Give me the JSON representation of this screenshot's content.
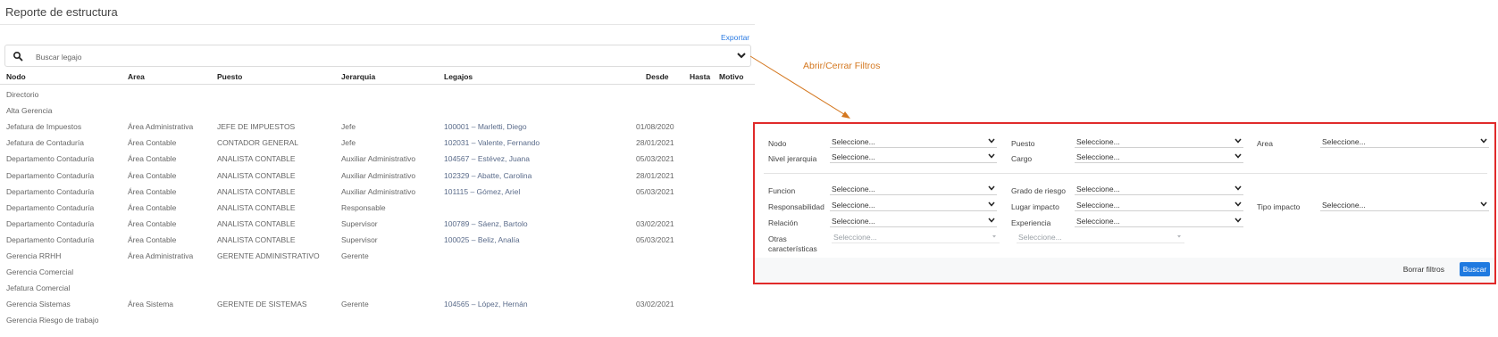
{
  "header": {
    "title": "Reporte de estructura",
    "export_label": "Exportar"
  },
  "search": {
    "placeholder": "Buscar legajo",
    "icon": "search-icon",
    "toggle_icon": "chevron-down-icon"
  },
  "table": {
    "columns": [
      "Nodo",
      "Area",
      "Puesto",
      "Jerarquia",
      "Legajos",
      "Desde",
      "Hasta",
      "Motivo"
    ],
    "rows": [
      {
        "nodo": "Directorio",
        "area": "",
        "puesto": "",
        "jerarquia": "",
        "legajos": "",
        "desde": "",
        "hasta": "",
        "motivo": ""
      },
      {
        "nodo": "Alta Gerencia",
        "area": "",
        "puesto": "",
        "jerarquia": "",
        "legajos": "",
        "desde": "",
        "hasta": "",
        "motivo": ""
      },
      {
        "nodo": "Jefatura de Impuestos",
        "area": "Área Administrativa",
        "puesto": "JEFE DE IMPUESTOS",
        "jerarquia": "Jefe",
        "legajos": "100001 – Marletti, Diego",
        "desde": "01/08/2020",
        "hasta": "",
        "motivo": ""
      },
      {
        "nodo": "Jefatura de Contaduría",
        "area": "Área Contable",
        "puesto": "CONTADOR GENERAL",
        "jerarquia": "Jefe",
        "legajos": "102031 – Valente, Fernando",
        "desde": "28/01/2021",
        "hasta": "",
        "motivo": ""
      },
      {
        "nodo": "Departamento Contaduría",
        "area": "Área Contable",
        "puesto": "ANALISTA CONTABLE",
        "jerarquia": "Auxiliar Administrativo",
        "legajos": "104567 – Estévez, Juana",
        "desde": "05/03/2021",
        "hasta": "",
        "motivo": ""
      },
      {
        "nodo": "Departamento Contaduría",
        "area": "Área Contable",
        "puesto": "ANALISTA CONTABLE",
        "jerarquia": "Auxiliar Administrativo",
        "legajos": "102329 – Abatte, Carolina",
        "desde": "28/01/2021",
        "hasta": "",
        "motivo": ""
      },
      {
        "nodo": "Departamento Contaduría",
        "area": "Área Contable",
        "puesto": "ANALISTA CONTABLE",
        "jerarquia": "Auxiliar Administrativo",
        "legajos": "101115 – Gómez, Ariel",
        "desde": "05/03/2021",
        "hasta": "",
        "motivo": ""
      },
      {
        "nodo": "Departamento Contaduría",
        "area": "Área Contable",
        "puesto": "ANALISTA CONTABLE",
        "jerarquia": "Responsable",
        "legajos": "",
        "desde": "",
        "hasta": "",
        "motivo": ""
      },
      {
        "nodo": "Departamento Contaduría",
        "area": "Área Contable",
        "puesto": "ANALISTA CONTABLE",
        "jerarquia": "Supervisor",
        "legajos": "100789 – Sáenz, Bartolo",
        "desde": "03/02/2021",
        "hasta": "",
        "motivo": ""
      },
      {
        "nodo": "Departamento Contaduría",
        "area": "Área Contable",
        "puesto": "ANALISTA CONTABLE",
        "jerarquia": "Supervisor",
        "legajos": "100025 – Beliz, Analía",
        "desde": "05/03/2021",
        "hasta": "",
        "motivo": ""
      },
      {
        "nodo": "Gerencia RRHH",
        "area": "Área Administrativa",
        "puesto": "GERENTE ADMINISTRATIVO",
        "jerarquia": "Gerente",
        "legajos": "",
        "desde": "",
        "hasta": "",
        "motivo": ""
      },
      {
        "nodo": "Gerencia Comercial",
        "area": "",
        "puesto": "",
        "jerarquia": "",
        "legajos": "",
        "desde": "",
        "hasta": "",
        "motivo": ""
      },
      {
        "nodo": "Jefatura Comercial",
        "area": "",
        "puesto": "",
        "jerarquia": "",
        "legajos": "",
        "desde": "",
        "hasta": "",
        "motivo": ""
      },
      {
        "nodo": "Gerencia Sistemas",
        "area": "Área Sistema",
        "puesto": "GERENTE DE SISTEMAS",
        "jerarquia": "Gerente",
        "legajos": "104565 – López, Hernán",
        "desde": "03/02/2021",
        "hasta": "",
        "motivo": ""
      },
      {
        "nodo": "Gerencia Riesgo de trabajo",
        "area": "",
        "puesto": "",
        "jerarquia": "",
        "legajos": "",
        "desde": "",
        "hasta": "",
        "motivo": ""
      }
    ]
  },
  "annotation": {
    "text": "Abrir/Cerrar Filtros",
    "color": "#d4771f"
  },
  "filters": {
    "border_color": "#e02a2a",
    "select_placeholder": "Seleccione...",
    "labels": {
      "nodo": "Nodo",
      "puesto": "Puesto",
      "area": "Area",
      "nivel_jerarquia": "Nivel jerarquia",
      "cargo": "Cargo",
      "funcion": "Funcion",
      "grado_riesgo": "Grado de riesgo",
      "responsabilidad": "Responsabilidad",
      "lugar_impacto": "Lugar impacto",
      "tipo_impacto": "Tipo impacto",
      "relacion": "Relación",
      "experiencia": "Experiencia",
      "otras_caracteristicas": "Otras características"
    },
    "clear_label": "Borrar filtros",
    "search_label": "Buscar",
    "accent_color": "#1f7ae0"
  }
}
